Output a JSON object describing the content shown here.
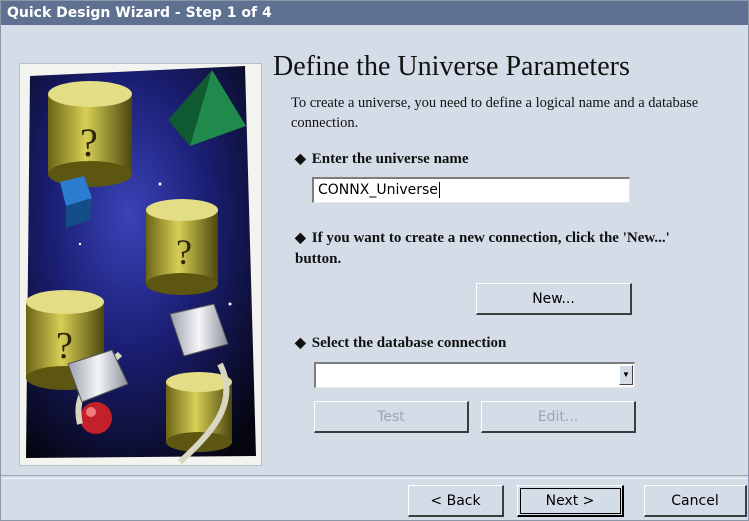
{
  "window": {
    "title": "Quick Design Wizard - Step 1 of 4"
  },
  "page": {
    "heading": "Define the Universe Parameters",
    "intro": "To create a universe, you need to define a logical name and a database connection."
  },
  "step_universe_name": {
    "bullet_icon": "diamond-bullet-icon",
    "label": "Enter the universe name",
    "value": "CONNX_Universe"
  },
  "step_new_connection": {
    "bullet_icon": "diamond-bullet-icon",
    "label": "If you want to create a new connection, click the 'New...' button.",
    "button_label": "New..."
  },
  "step_select_connection": {
    "bullet_icon": "diamond-bullet-icon",
    "label": "Select the database connection",
    "selected_value": "",
    "test_label": "Test",
    "edit_label": "Edit..."
  },
  "footer": {
    "back_label": "< Back",
    "next_label": "Next >",
    "cancel_label": "Cancel"
  },
  "colors": {
    "titlebar": "#5e7190",
    "dialog_background": "#d4dce8",
    "disabled_text": "#9ca5b2"
  }
}
